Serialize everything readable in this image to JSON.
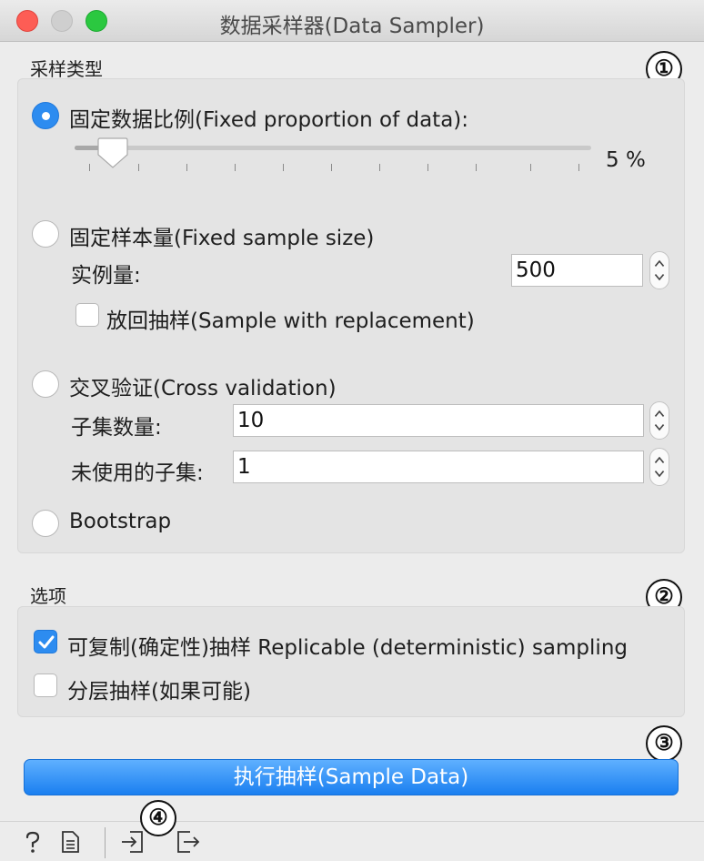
{
  "window": {
    "title": "数据采样器(Data Sampler)"
  },
  "sampling_type": {
    "heading": "采样类型",
    "fixed_proportion": {
      "label": "固定数据比例(Fixed proportion of data):",
      "selected": true,
      "value_text": "5 %",
      "value_fraction": 0.05
    },
    "fixed_size": {
      "label": "固定样本量(Fixed sample size)",
      "selected": false,
      "instances_label": "实例量:",
      "instances_value": "500",
      "replacement_label": "放回抽样(Sample with replacement)",
      "replacement_checked": false
    },
    "cross_validation": {
      "label": "交叉验证(Cross validation)",
      "selected": false,
      "folds_label": "子集数量:",
      "folds_value": "10",
      "unused_label": "未使用的子集:",
      "unused_value": "1"
    },
    "bootstrap": {
      "label": "Bootstrap",
      "selected": false
    }
  },
  "options": {
    "heading": "选项",
    "replicable": {
      "label": "可复制(确定性)抽样 Replicable (deterministic) sampling",
      "checked": true
    },
    "stratify": {
      "label": "分层抽样(如果可能)",
      "checked": false
    }
  },
  "actions": {
    "run_label": "执行抽样(Sample Data)"
  },
  "callouts": [
    "①",
    "②",
    "③",
    "④"
  ],
  "colors": {
    "accent": "#2d8cf0",
    "close": "#fd5d55",
    "maximize": "#2bc840"
  }
}
